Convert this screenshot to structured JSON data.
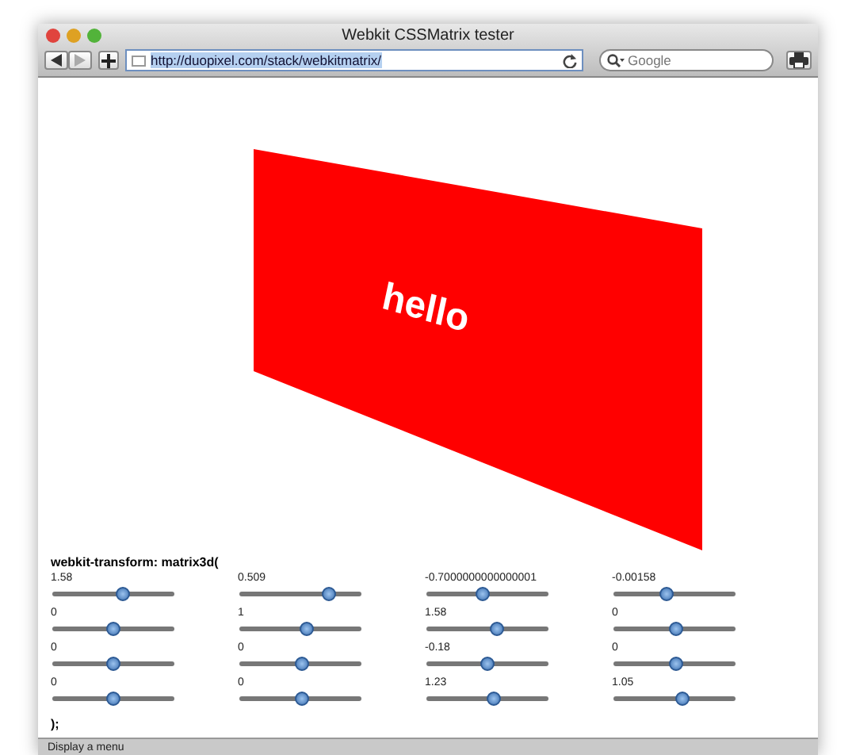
{
  "window": {
    "title": "Webkit CSSMatrix tester"
  },
  "toolbar": {
    "address": "http://duopixel.com/stack/webkitmatrix/",
    "search_placeholder": "Google"
  },
  "page": {
    "card_text": "hello",
    "heading": "webkit-transform: matrix3d(",
    "sliders": [
      [
        {
          "value": "1.58",
          "level": 0.57
        },
        {
          "value": "0.509",
          "level": 0.73
        },
        {
          "value": "-0.7000000000000001",
          "level": 0.46
        },
        {
          "value": "-0.00158",
          "level": 0.43
        }
      ],
      [
        {
          "value": "0",
          "level": 0.49
        },
        {
          "value": "1",
          "level": 0.55
        },
        {
          "value": "1.58",
          "level": 0.57
        },
        {
          "value": "0",
          "level": 0.5
        }
      ],
      [
        {
          "value": "0",
          "level": 0.49
        },
        {
          "value": "0",
          "level": 0.5
        },
        {
          "value": "-0.18",
          "level": 0.49
        },
        {
          "value": "0",
          "level": 0.5
        }
      ],
      [
        {
          "value": "0",
          "level": 0.49
        },
        {
          "value": "0",
          "level": 0.5
        },
        {
          "value": "1.23",
          "level": 0.54
        },
        {
          "value": "1.05",
          "level": 0.56
        }
      ]
    ],
    "closing": ");"
  },
  "status_bar": "Display a menu"
}
